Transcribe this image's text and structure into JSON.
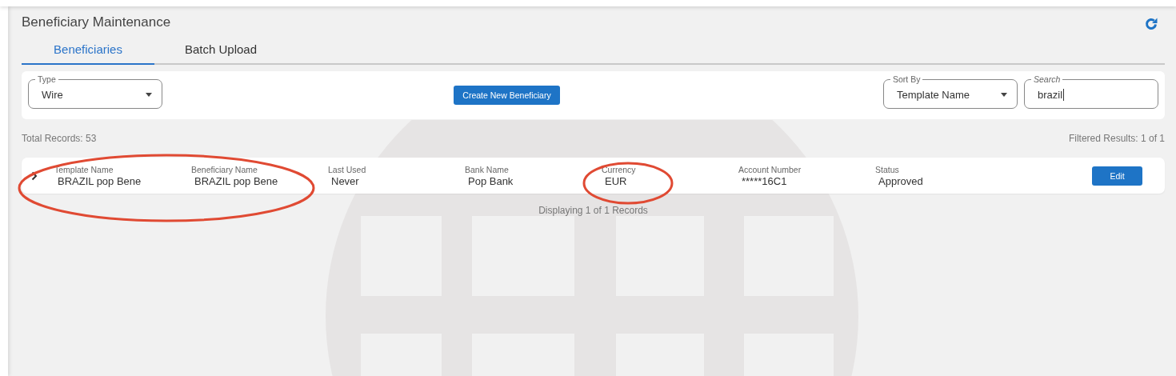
{
  "page": {
    "title": "Beneficiary Maintenance"
  },
  "tabs": [
    {
      "label": "Beneficiaries",
      "selected": true
    },
    {
      "label": "Batch Upload",
      "selected": false
    }
  ],
  "filters": {
    "type": {
      "label": "Type",
      "value": "Wire"
    },
    "create_button": "Create New Beneficiary",
    "sort_by": {
      "label": "Sort By",
      "value": "Template Name"
    },
    "search": {
      "label": "Search",
      "value": "brazil"
    }
  },
  "total_records": "Total Records: 53",
  "filtered_results": "Filtered Results: 1 of 1",
  "table": {
    "columns": [
      {
        "label": "Template Name",
        "circled": true
      },
      {
        "label": "Beneficiary Name",
        "circled": true
      },
      {
        "label": "Last Used",
        "circled": false
      },
      {
        "label": "Bank Name",
        "circled": false
      },
      {
        "label": "Currency",
        "circled": true
      },
      {
        "label": "Account Number",
        "circled": false
      },
      {
        "label": "Status",
        "circled": false
      }
    ],
    "rows": [
      {
        "expanded": false,
        "cells": [
          "BRAZIL pop Bene",
          "BRAZIL pop Bene",
          "Never",
          "Pop Bank",
          "EUR",
          "*****16C1",
          "Approved"
        ],
        "action": "Edit"
      }
    ]
  },
  "displaying": "Displaying 1 of 1 Records"
}
